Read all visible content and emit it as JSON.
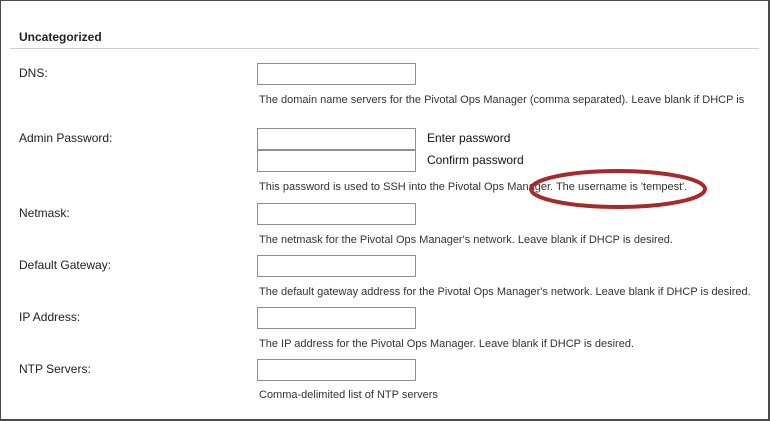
{
  "section": {
    "title": "Uncategorized"
  },
  "fields": {
    "dns": {
      "label": "DNS:",
      "value": "",
      "placeholder": "",
      "hint": "The domain name servers for the Pivotal Ops Manager (comma separated). Leave blank if DHCP is"
    },
    "admin_password": {
      "label": "Admin Password:",
      "enter_label": "Enter password",
      "confirm_label": "Confirm password",
      "value": "",
      "confirm_value": "",
      "hint": "This password is used to SSH into the Pivotal Ops Manager. The username is 'tempest'."
    },
    "netmask": {
      "label": "Netmask:",
      "value": "",
      "hint": "The netmask for the Pivotal Ops Manager's network. Leave blank if DHCP is desired."
    },
    "default_gateway": {
      "label": "Default Gateway:",
      "value": "",
      "hint": "The default gateway address for the Pivotal Ops Manager's network. Leave blank if DHCP is desired."
    },
    "ip_address": {
      "label": "IP Address:",
      "value": "",
      "hint": "The IP address for the Pivotal Ops Manager. Leave blank if DHCP is desired."
    },
    "ntp_servers": {
      "label": "NTP Servers:",
      "value": "",
      "hint": "Comma-delimited list of NTP servers"
    }
  },
  "colors": {
    "annotation": "#a52a2a",
    "border": "#8f8f8f"
  }
}
